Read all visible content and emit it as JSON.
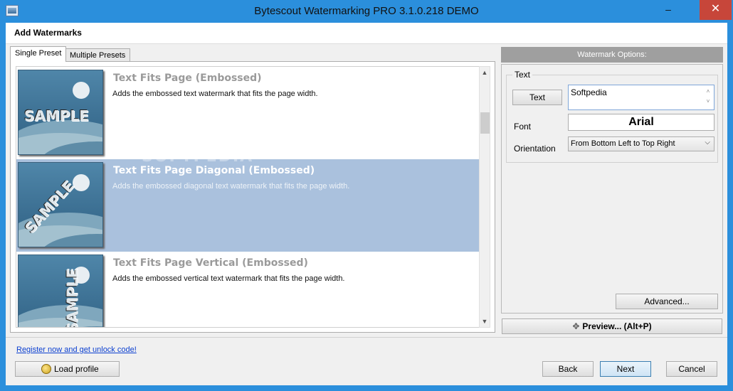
{
  "window": {
    "title": "Bytescout Watermarking PRO 3.1.0.218 DEMO",
    "minimize": "–",
    "close": "✕"
  },
  "header": {
    "title": "Add Watermarks"
  },
  "tabs": [
    {
      "label": "Single Preset"
    },
    {
      "label": "Multiple Presets"
    }
  ],
  "presets": [
    {
      "title": "Text Fits Page (Embossed)",
      "description": "Adds the embossed text watermark that fits the page width.",
      "thumb_text": "SAMPLE"
    },
    {
      "title": "Text Fits Page Diagonal (Embossed)",
      "description": "Adds the embossed diagonal text watermark that fits the page width.",
      "thumb_text": "SAMPLE",
      "selected": true
    },
    {
      "title": "Text Fits Page Vertical (Embossed)",
      "description": "Adds the embossed vertical text watermark that fits the page width.",
      "thumb_text": "SAMPLE"
    }
  ],
  "overlay_watermark": "SOFTPEDIA",
  "scrollbar": {
    "up": "▲",
    "down": "▼"
  },
  "options": {
    "header": "Watermark Options:",
    "group_label": "Text",
    "text_button": "Text",
    "text_value": "Softpedia",
    "font_label": "Font",
    "font_value": "Arial",
    "orientation_label": "Orientation",
    "orientation_value": "From Bottom Left to Top Right",
    "advanced_button": "Advanced...",
    "preview_button": "Preview... (Alt+P)"
  },
  "footer": {
    "register_link": "Register now and get unlock code!",
    "load_profile": "Load profile",
    "back": "Back",
    "next": "Next",
    "cancel": "Cancel"
  },
  "colors": {
    "titlebar": "#2b8fdc",
    "close": "#c7463a",
    "selected_row": "#aac1dd",
    "link": "#0b3fd0"
  }
}
